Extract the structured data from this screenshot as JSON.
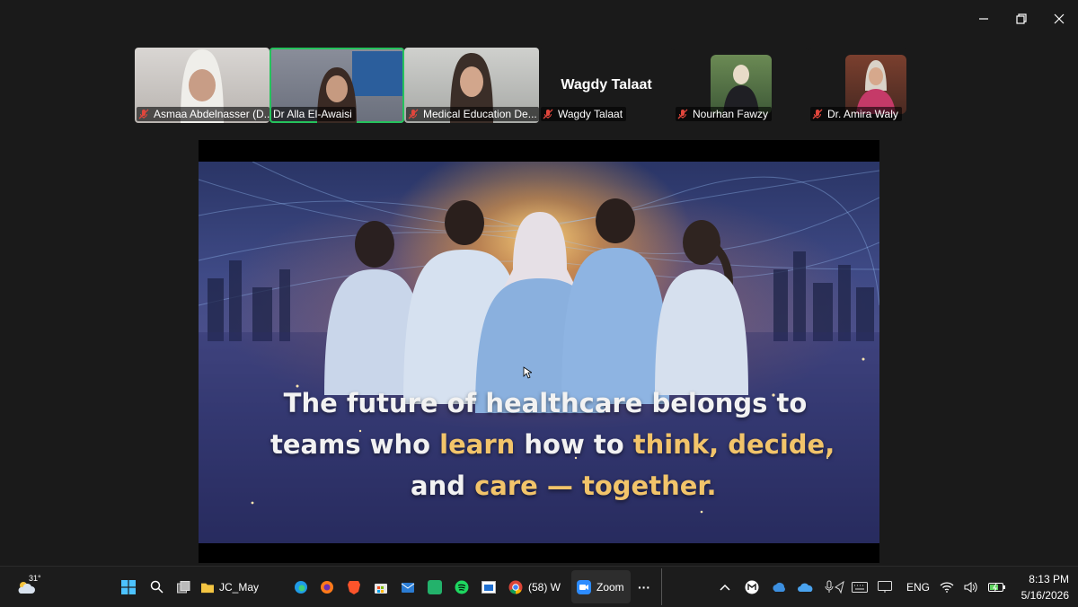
{
  "window": {
    "minimize_icon": "minimize-icon",
    "restore_icon": "restore-icon",
    "close_icon": "close-icon"
  },
  "participants": [
    {
      "name": "Asmaa Abdelnasser (D..."
    },
    {
      "name": "Dr Alla El-Awaisi"
    },
    {
      "name": "Medical Education De..."
    },
    {
      "name": "Wagdy Talaat",
      "display_name": "Wagdy Talaat"
    },
    {
      "name": "Nourhan Fawzy"
    },
    {
      "name": "Dr. Amira Waly"
    }
  ],
  "slide": {
    "line1": "The future of healthcare belongs to",
    "line2_a": "teams who ",
    "line2_b": "learn",
    "line2_c": " how to ",
    "line2_d": "think, decide,",
    "line3_a": "and ",
    "line3_b": "care — together."
  },
  "taskbar": {
    "weather_temp": "31°",
    "folder_label": "JC_May",
    "chrome_label": "(58) W",
    "zoom_label": "Zoom",
    "more_label": "···",
    "language": "ENG",
    "time": "8:13 PM",
    "date": "5/16/2026"
  },
  "colors": {
    "active_speaker": "#25c25c",
    "highlight_text": "#f2c46a",
    "taskbar_bg": "#1c1c1c",
    "muted_mic": "#e0463c"
  }
}
